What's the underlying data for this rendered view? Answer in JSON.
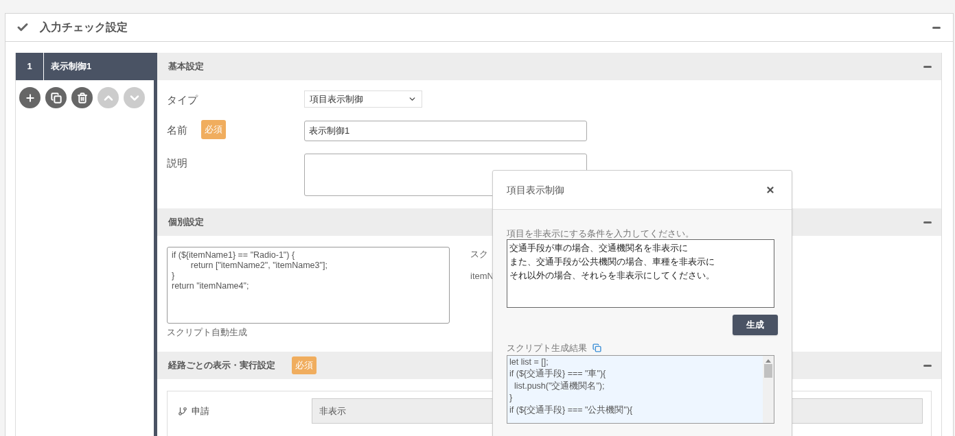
{
  "panel": {
    "title": "入力チェック設定"
  },
  "list": {
    "items": [
      {
        "number": "1",
        "name": "表示制御1",
        "selected": true
      }
    ],
    "actions": [
      {
        "kind": "add",
        "disabled": false
      },
      {
        "kind": "copy",
        "disabled": false
      },
      {
        "kind": "delete",
        "disabled": false
      },
      {
        "kind": "up",
        "disabled": true
      },
      {
        "kind": "down",
        "disabled": true
      }
    ]
  },
  "basic": {
    "title": "基本設定",
    "fields": [
      {
        "kind": "select",
        "label": "タイプ",
        "value": "項目表示制御"
      },
      {
        "kind": "text",
        "label": "名前",
        "badge": "必須",
        "value": "表示制御1"
      },
      {
        "kind": "textarea",
        "label": "説明"
      }
    ]
  },
  "individual": {
    "title": "個別設定",
    "script": "if (${itemName1} == \"Radio-1\") {\n\treturn [\"itemName2\", \"itemName3\"];\n}\nreturn \"itemName4\";",
    "caption": "スクリプト自動生成",
    "side_texts": [
      "スク",
      "itemN"
    ]
  },
  "routes": {
    "title": "経路ごとの表示・実行設定",
    "badge": "必須",
    "rows": [
      {
        "label": "申請",
        "value": "非表示"
      }
    ]
  },
  "dialog": {
    "title": "項目表示制御",
    "prompt_label": "項目を非表示にする条件を入力してください。",
    "prompt_lines": [
      "交通手段が車の場合、交通機関名を非表示に",
      "また、交通手段が公共機関の場合、車種を非表示に",
      "それ以外の場合、それらを非表示にしてください。"
    ],
    "button": "生成",
    "result_label": "スクリプト生成結果",
    "result": "let list = [];\nif (${交通手段} === \"車\"){\n  list.push(\"交通機関名\");\n}\nif (${交通手段} === \"公共機関\"){"
  }
}
